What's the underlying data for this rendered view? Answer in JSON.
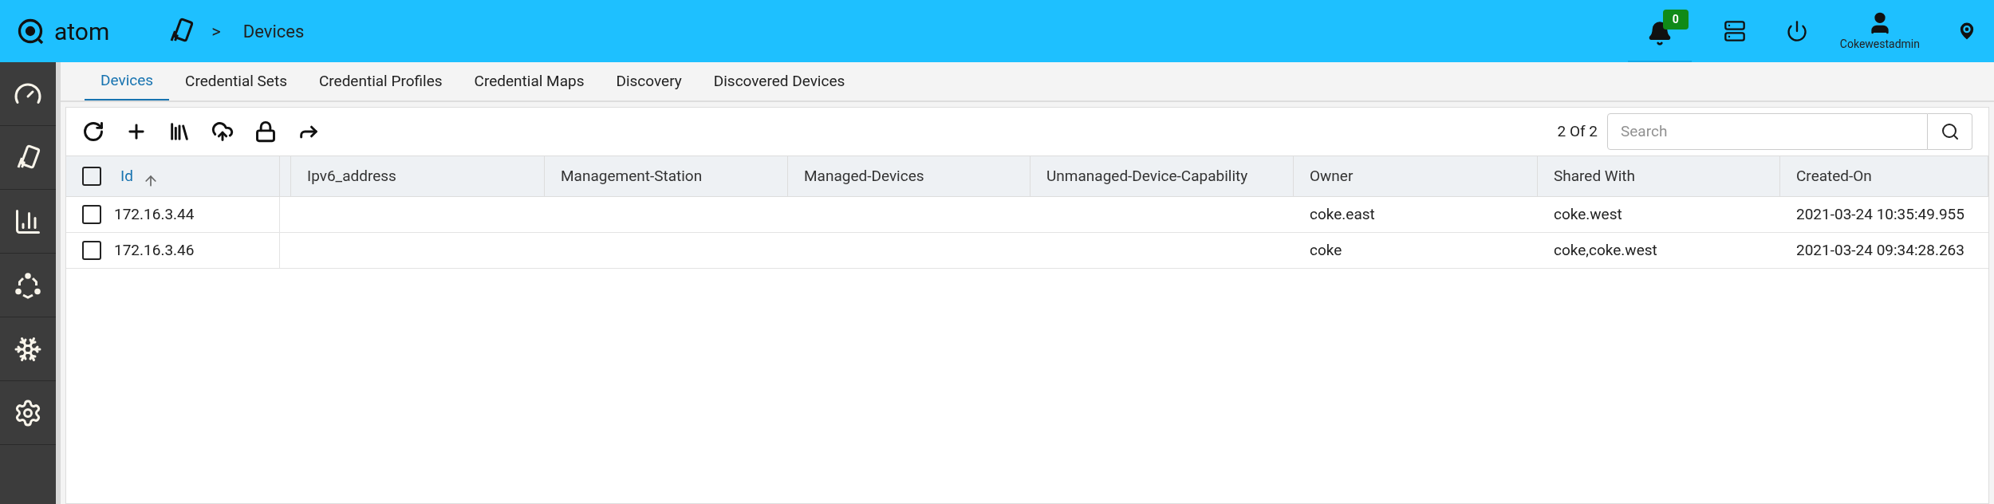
{
  "header": {
    "logo": "atom",
    "breadcrumb_separator": ">",
    "breadcrumb": "Devices",
    "notification_count": "0",
    "user": "Cokewestadmin"
  },
  "tabs": [
    {
      "label": "Devices",
      "selected": true
    },
    {
      "label": "Credential Sets",
      "selected": false
    },
    {
      "label": "Credential Profiles",
      "selected": false
    },
    {
      "label": "Credential Maps",
      "selected": false
    },
    {
      "label": "Discovery",
      "selected": false
    },
    {
      "label": "Discovered Devices",
      "selected": false
    }
  ],
  "toolbar": {
    "count": "2 Of 2",
    "search": {
      "placeholder": "Search"
    }
  },
  "table": {
    "select_all": {
      "checked": false
    },
    "columns": [
      {
        "label": "Id",
        "sorted": true
      },
      {
        "label": "Ipv6_address",
        "sorted": false
      },
      {
        "label": "Management-Station",
        "sorted": false
      },
      {
        "label": "Managed-Devices",
        "sorted": false
      },
      {
        "label": "Unmanaged-Device-Capability",
        "sorted": false
      },
      {
        "label": "Owner",
        "sorted": false
      },
      {
        "label": "Shared With",
        "sorted": false
      },
      {
        "label": "Created-On",
        "sorted": false
      }
    ],
    "rows": [
      {
        "checked": false,
        "cells": [
          "172.16.3.44",
          "",
          "",
          "",
          "",
          "coke.east",
          "coke.west",
          "2021-03-24 10:35:49.955"
        ]
      },
      {
        "checked": false,
        "cells": [
          "172.16.3.46",
          "",
          "",
          "",
          "",
          "coke",
          "coke,coke.west",
          "2021-03-24 09:34:28.263"
        ]
      }
    ]
  }
}
